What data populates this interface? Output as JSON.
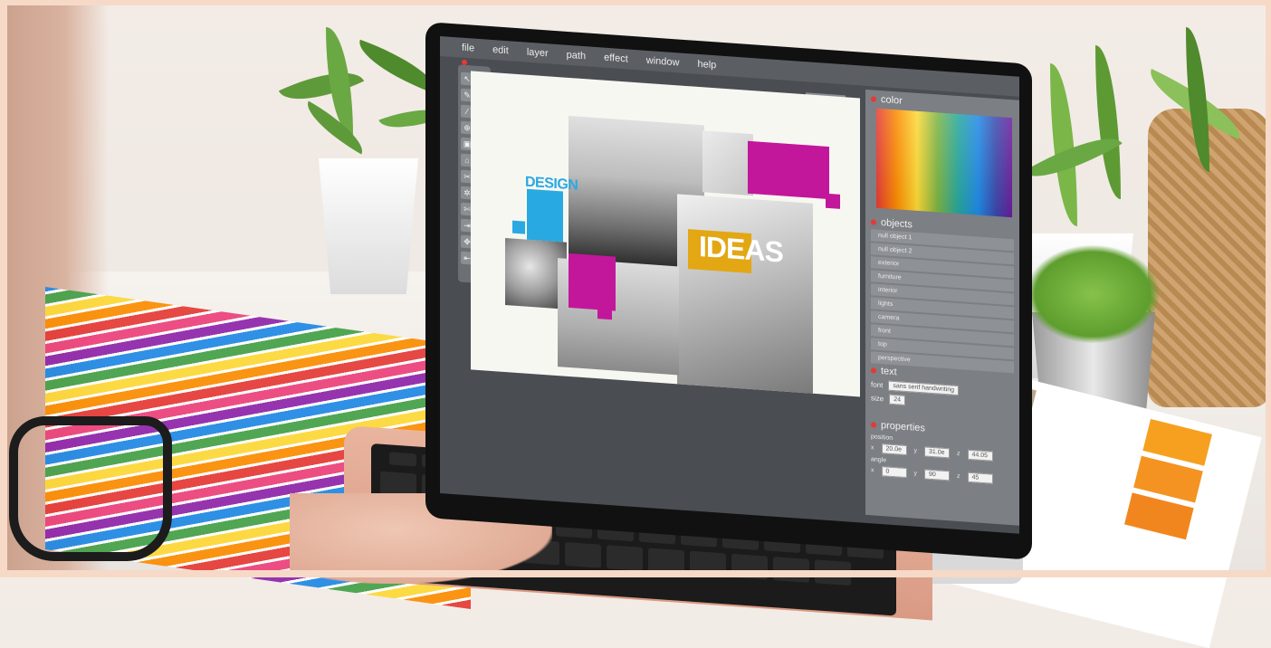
{
  "menu": {
    "items": [
      "file",
      "edit",
      "layer",
      "path",
      "effect",
      "window",
      "help"
    ]
  },
  "artboard": {
    "perspective_badge": "perspective",
    "design_text": "DESIGN",
    "ideas_text": "IDEAS"
  },
  "panel": {
    "color_title": "color",
    "objects_title": "objects",
    "objects": [
      "null object 1",
      "null object 2",
      "exterior",
      "furniture",
      "interior",
      "lights",
      "camera",
      "front",
      "top",
      "perspective"
    ],
    "text_title": "text",
    "font_label": "font",
    "font_value": "sans serif handwriting",
    "size_label": "size",
    "size_value": "24",
    "properties_title": "properties",
    "position_label": "position",
    "position": {
      "x": "20.0e",
      "y": "31.0e",
      "z": "44.05"
    },
    "angle_label": "angle",
    "angle": {
      "x": "0",
      "y": "90",
      "z": "45"
    },
    "axis_x": "x",
    "axis_y": "y",
    "axis_z": "z"
  },
  "colors": {
    "accent_blue": "#29a9e1",
    "accent_magenta": "#c2179b",
    "accent_yellow": "#e3a714",
    "app_dark": "#4a4d52",
    "panel_gray": "#7c7f84"
  },
  "icons": [
    "select-arrow-icon",
    "direct-select-icon",
    "pen-icon",
    "document-icon",
    "eyedropper-icon",
    "brush-icon",
    "zoom-in-icon",
    "zoom-out-icon",
    "lock-icon",
    "edit-icon",
    "home-icon",
    "home-filled-icon",
    "scissors-icon",
    "layers-icon",
    "gear-icon",
    "text-icon",
    "cut-icon",
    "save-icon",
    "export-icon",
    "rotate-icon",
    "move-icon",
    "crosshair-icon",
    "import-icon",
    "trash-icon"
  ]
}
